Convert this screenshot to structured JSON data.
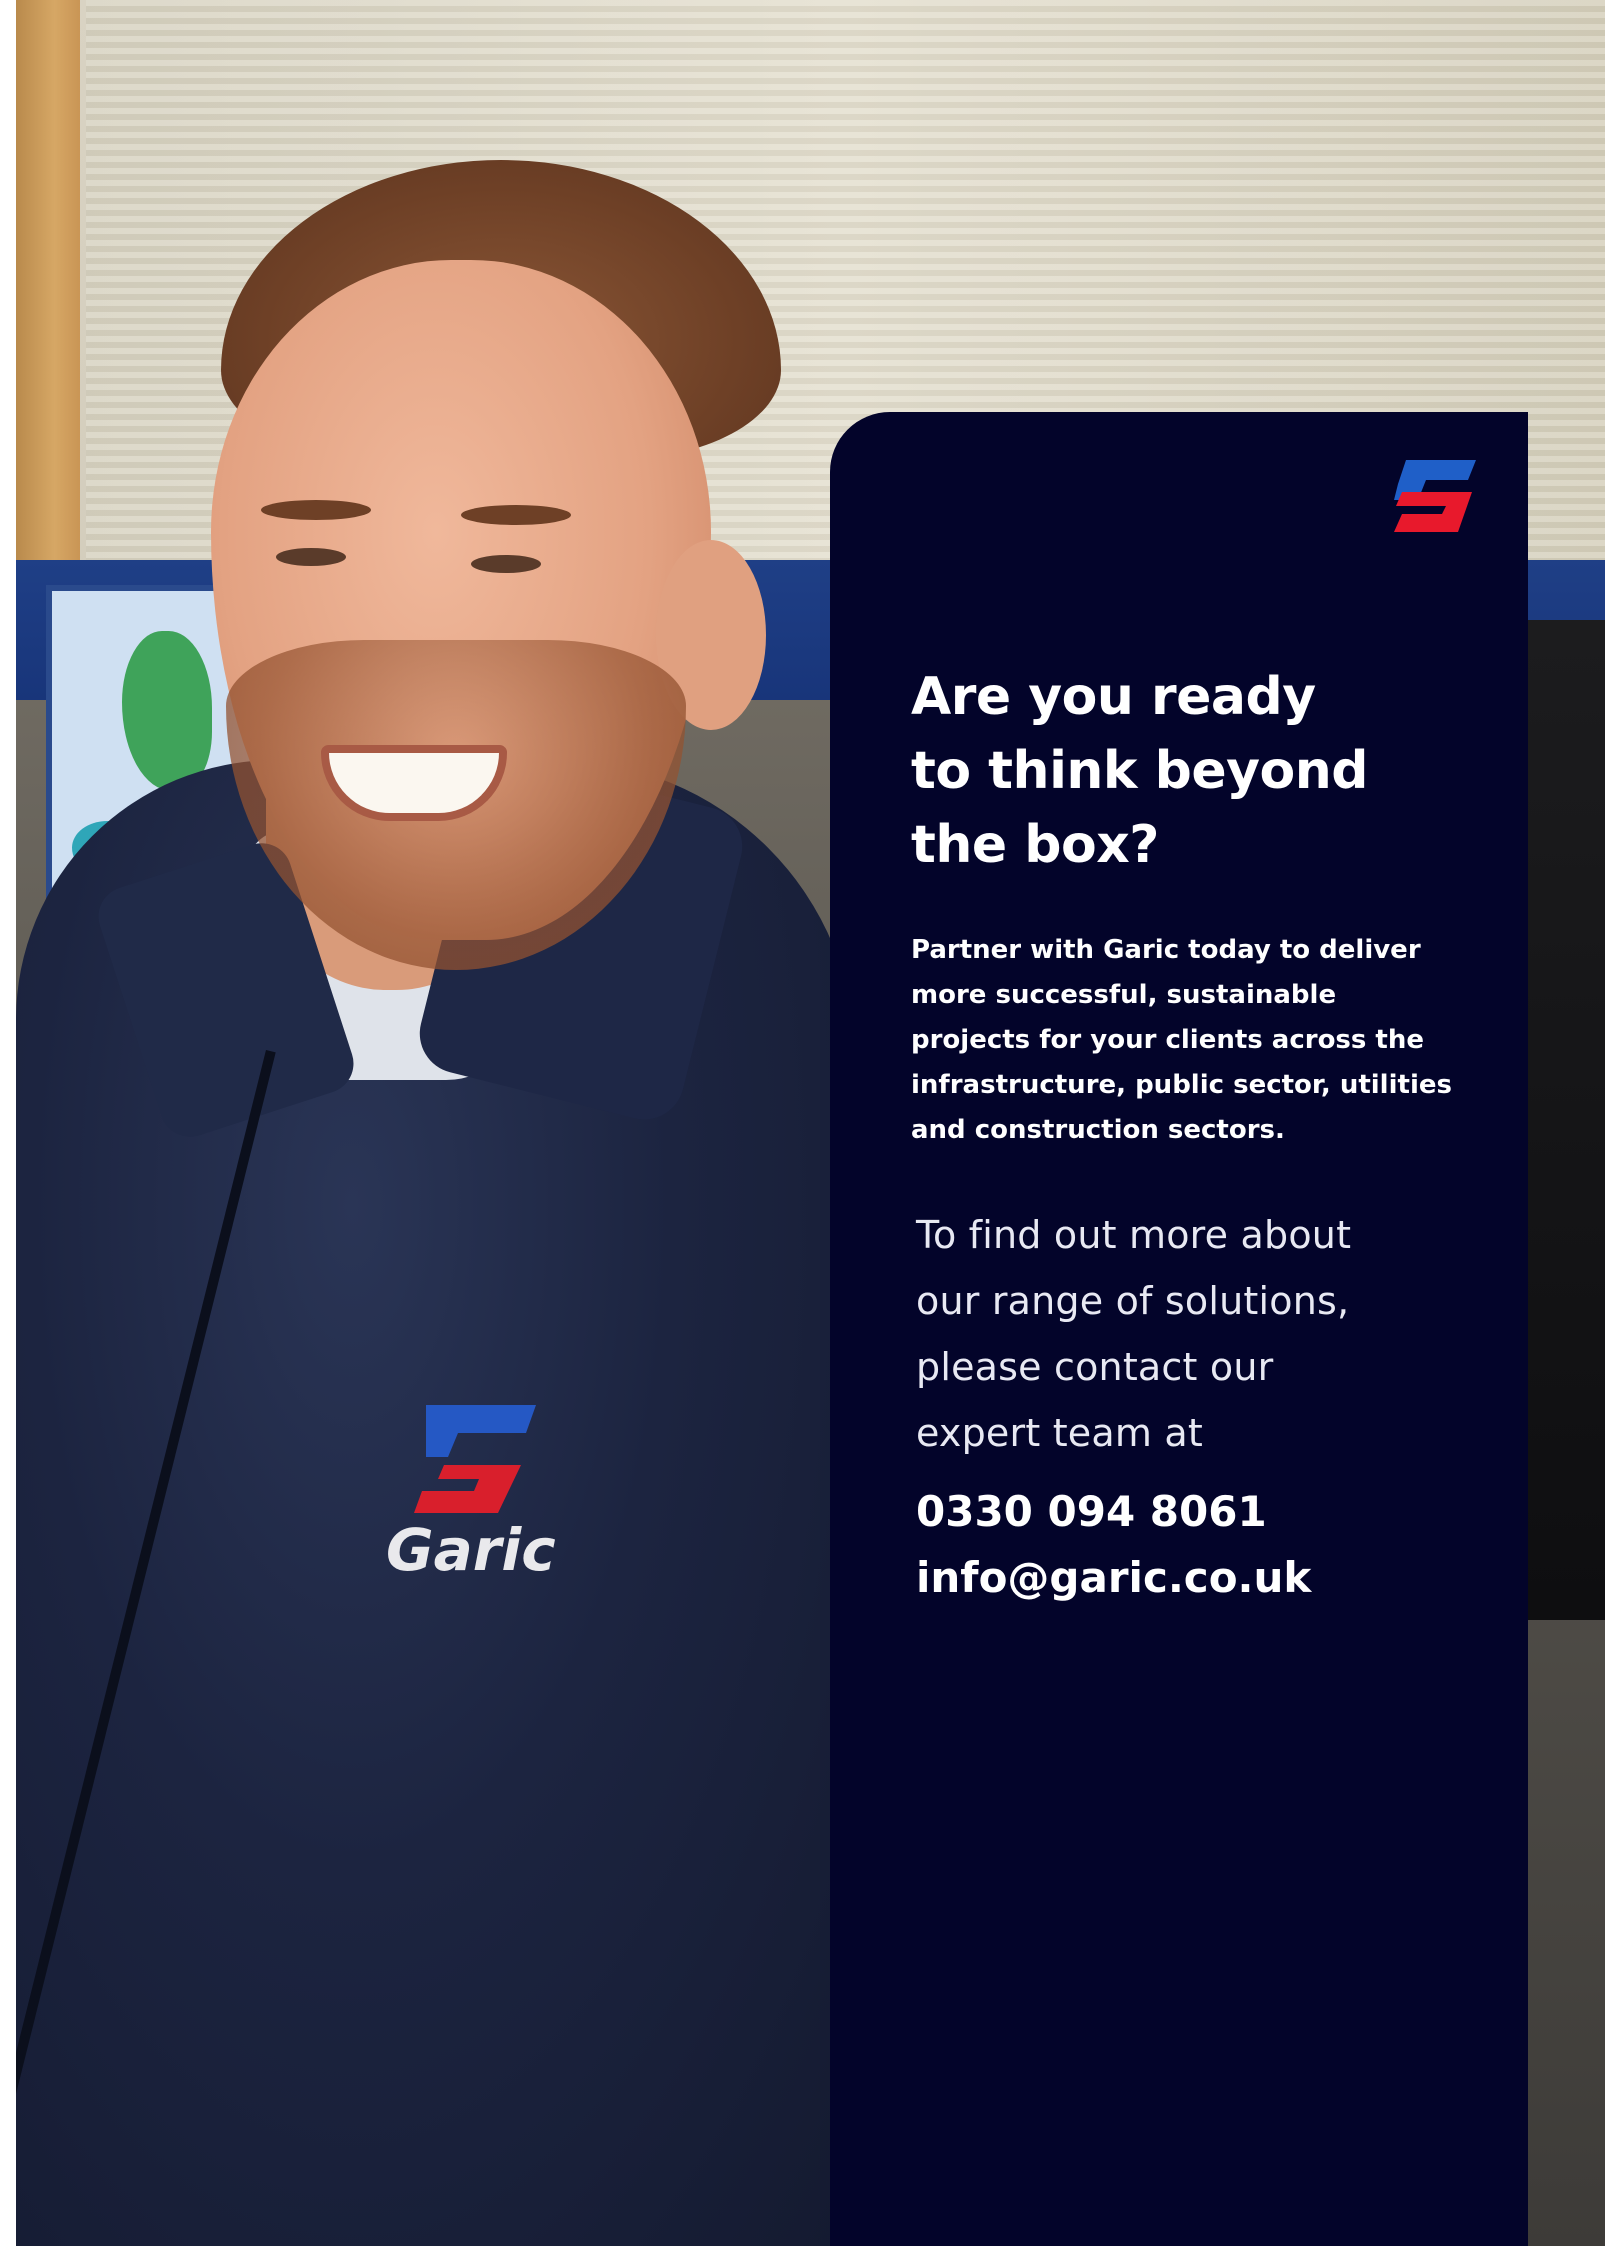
{
  "colors": {
    "panel_bg": "#03042a",
    "text": "#ffffff",
    "brand_blue": "#1f5fc8",
    "brand_red": "#e8192c"
  },
  "photo": {
    "jacket_logo_text": "Garic"
  },
  "panel": {
    "headline": [
      "Are you ready",
      "to think beyond",
      "the box?"
    ],
    "lead": [
      "Partner with Garic today to deliver",
      "more successful, sustainable",
      "projects for your clients across the",
      "infrastructure, public sector, utilities",
      "and construction sectors."
    ],
    "contact_intro": [
      "To find out more about",
      "our range of solutions,",
      "please contact our",
      "expert team at"
    ],
    "phone": "0330 094 8061",
    "email": "info@garic.co.uk"
  }
}
